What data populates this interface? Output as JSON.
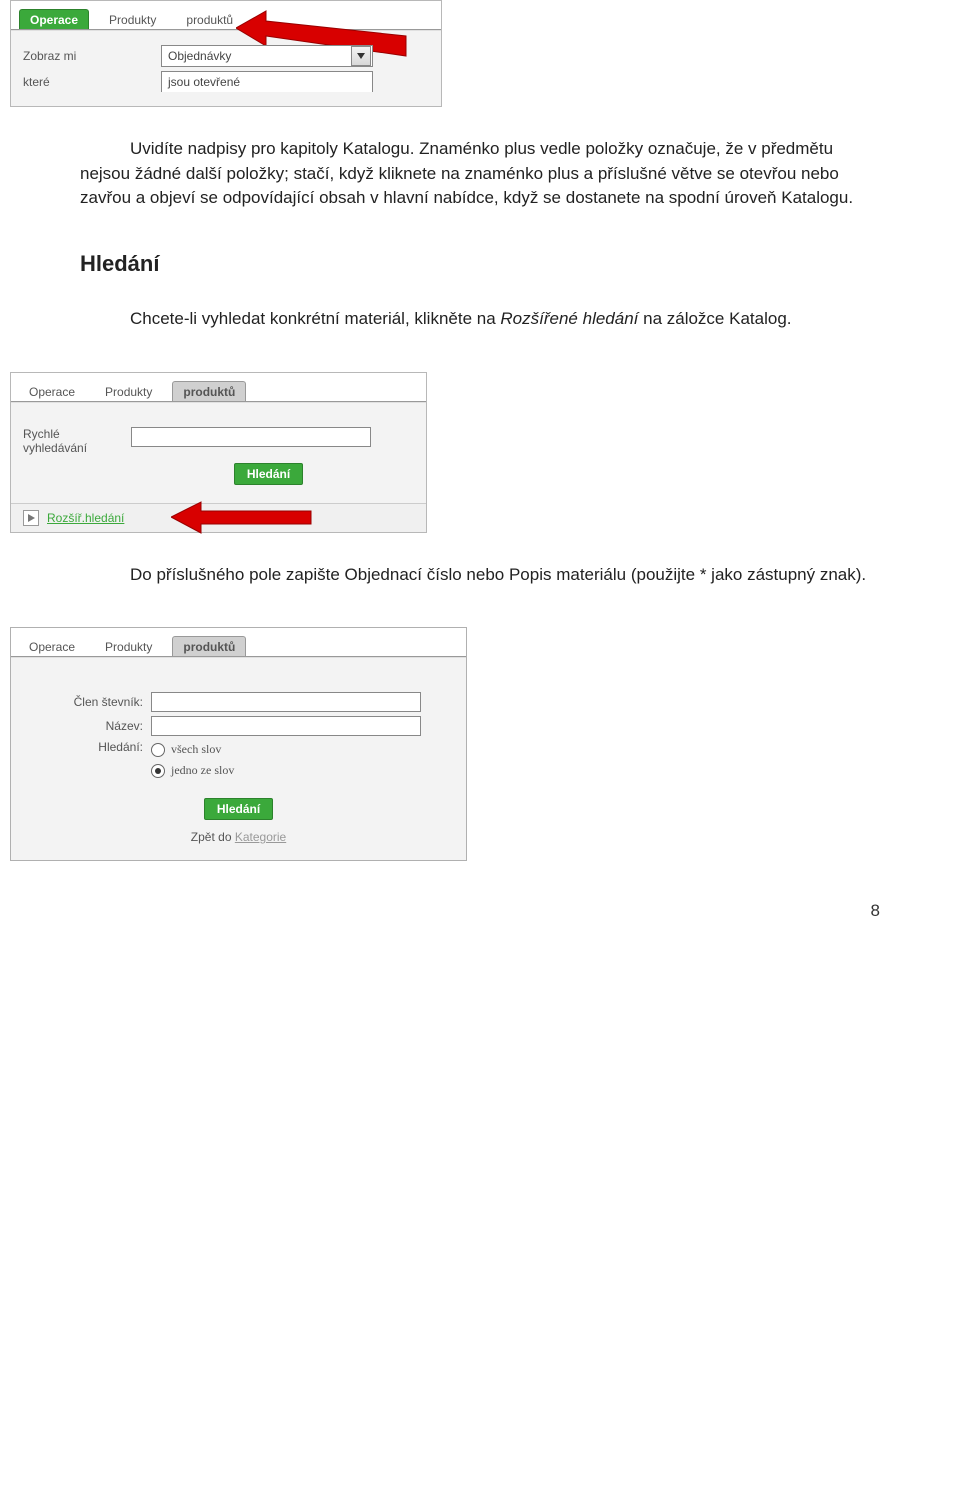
{
  "screenshot1": {
    "tabs": {
      "operace": "Operace",
      "produkty": "Produkty",
      "produktu": "produktů"
    },
    "row1": {
      "label": "Zobraz mi",
      "value": "Objednávky"
    },
    "row2": {
      "label": "které",
      "value": "jsou otevřené"
    }
  },
  "para1": "Uvidíte nadpisy pro kapitoly Katalogu. Znaménko plus vedle položky označuje, že v předmětu nejsou žádné další položky; stačí, když kliknete na znaménko plus a příslušné větve se otevřou nebo zavřou a objeví se odpovídající obsah v hlavní nabídce, když se dostanete na spodní úroveň Katalogu.",
  "heading": "Hledání",
  "para2_prefix": "Chcete-li vyhledat konkrétní materiál, klikněte na ",
  "para2_italic": "Rozšířené hledání",
  "para2_suffix": " na záložce Katalog.",
  "screenshot2": {
    "tabs": {
      "operace": "Operace",
      "produkty": "Produkty",
      "produktu": "produktů"
    },
    "quicklabel1": "Rychlé",
    "quicklabel2": "vyhledávání",
    "searchbtn": "Hledání",
    "advancedlink": "Rozšíř.hledání"
  },
  "para3": "Do příslušného pole zapište Objednací číslo nebo Popis materiálu (použijte * jako zástupný znak).",
  "screenshot3": {
    "tabs": {
      "operace": "Operace",
      "produkty": "Produkty",
      "produktu": "produktů"
    },
    "field1": "Člen števník:",
    "field2": "Název:",
    "field3": "Hledání:",
    "radio1": "všech slov",
    "radio2": "jedno ze slov",
    "searchbtn": "Hledání",
    "backprefix": "Zpět do ",
    "backlink": "Kategorie"
  },
  "page_number": "8"
}
